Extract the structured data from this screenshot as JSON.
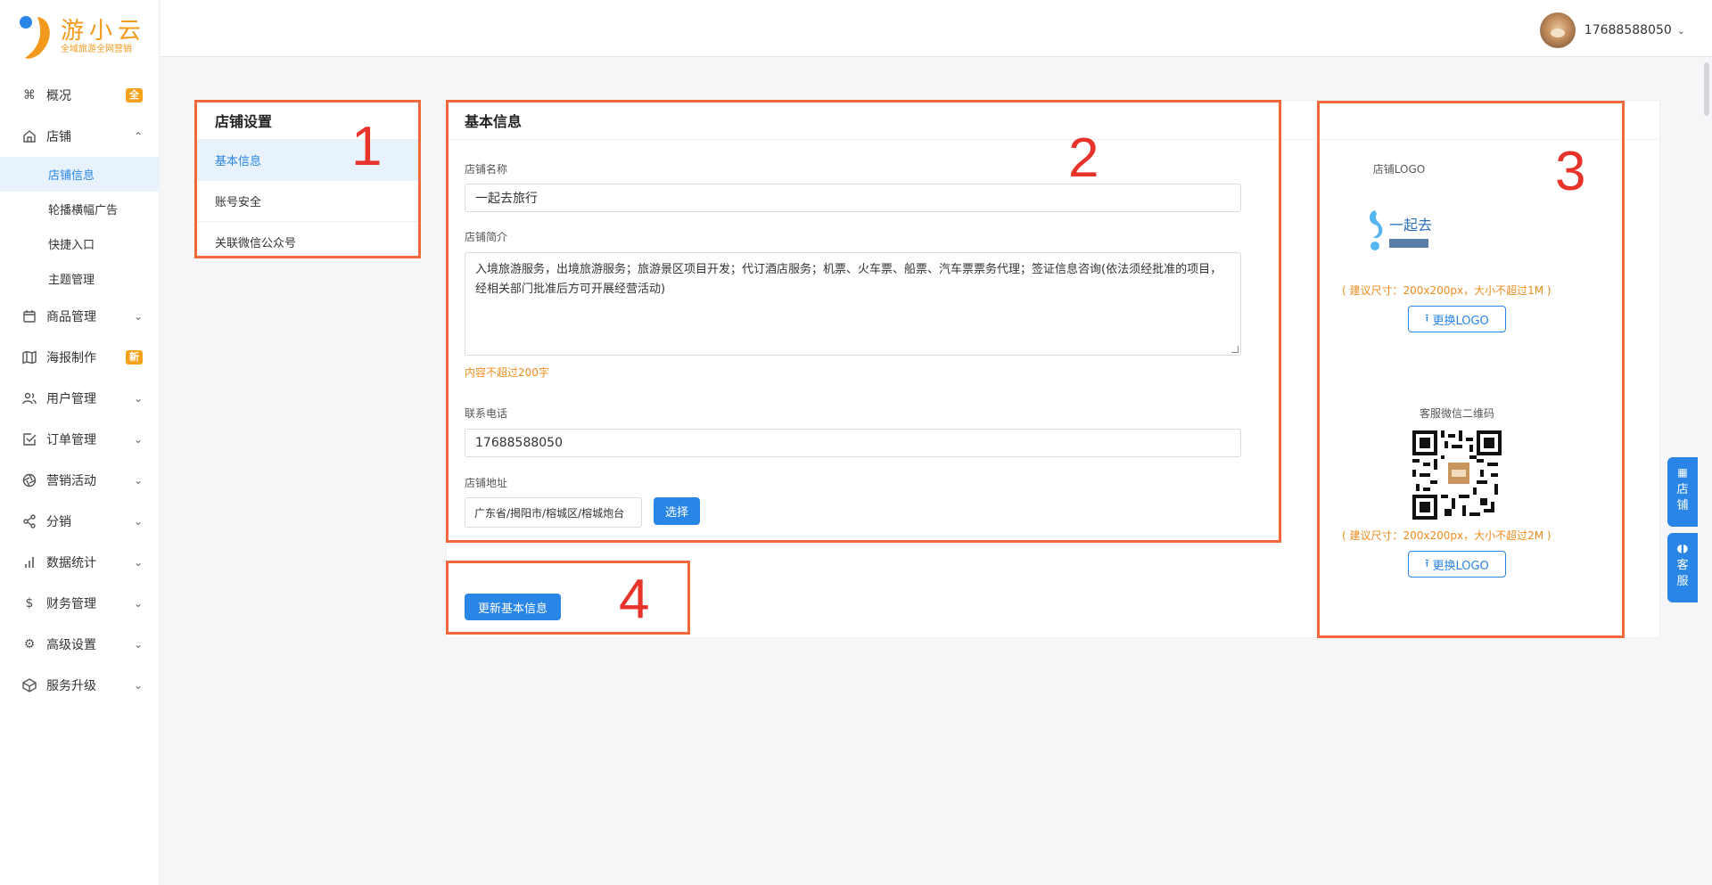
{
  "brand": {
    "title": "游小云",
    "subtitle": "全域旅游全网营销"
  },
  "sidebar": {
    "items": [
      {
        "label": "概况",
        "badge": "全",
        "icon": "command-icon"
      },
      {
        "label": "店铺",
        "icon": "home-icon",
        "expanded": true
      },
      {
        "label": "商品管理",
        "icon": "calendar-icon"
      },
      {
        "label": "海报制作",
        "badge": "新",
        "icon": "map-icon"
      },
      {
        "label": "用户管理",
        "icon": "users-icon"
      },
      {
        "label": "订单管理",
        "icon": "checkbox-icon"
      },
      {
        "label": "营销活动",
        "icon": "aperture-icon"
      },
      {
        "label": "分销",
        "icon": "share-icon"
      },
      {
        "label": "数据统计",
        "icon": "bar-chart-icon"
      },
      {
        "label": "财务管理",
        "icon": "dollar-icon"
      },
      {
        "label": "高级设置",
        "icon": "settings-icon"
      },
      {
        "label": "服务升级",
        "icon": "codesandbox-icon"
      }
    ],
    "shop_sub": [
      "店铺信息",
      "轮播横幅广告",
      "快捷入口",
      "主题管理"
    ]
  },
  "header": {
    "username": "17688588050"
  },
  "settings_menu": {
    "title": "店铺设置",
    "items": [
      "基本信息",
      "账号安全",
      "关联微信公众号"
    ]
  },
  "main": {
    "title": "基本信息",
    "shop_name_label": "店铺名称",
    "shop_name_value": "一起去旅行",
    "intro_label": "店铺简介",
    "intro_value": "入境旅游服务，出境旅游服务；旅游景区项目开发；代订酒店服务；机票、火车票、船票、汽车票票务代理；签证信息咨询(依法须经批准的项目，经相关部门批准后方可开展经营活动)",
    "intro_hint": "内容不超过200字",
    "phone_label": "联系电话",
    "phone_value": "17688588050",
    "address_label": "店铺地址",
    "address_value": "广东省/揭阳市/榕城区/榕城炮台",
    "select_button": "选择",
    "update_button": "更新基本信息"
  },
  "logo_panel": {
    "logo_label": "店铺LOGO",
    "logo_hint": "( 建议尺寸：200x200px，大小不超过1M )",
    "logo_button": "更换LOGO",
    "logo_image_text": "一起去",
    "qr_label": "客服微信二维码",
    "qr_hint": "( 建议尺寸：200x200px，大小不超过2M )",
    "qr_button": "更换LOGO"
  },
  "annotations": [
    "1",
    "2",
    "3",
    "4"
  ],
  "float_buttons": [
    {
      "chars": [
        "店",
        "铺"
      ],
      "icon": "grid-icon"
    },
    {
      "chars": [
        "客",
        "服"
      ],
      "icon": "headset-icon"
    }
  ],
  "colors": {
    "primary": "#2a86e6",
    "accent": "#f39a1e",
    "annotation": "#f0693a"
  }
}
